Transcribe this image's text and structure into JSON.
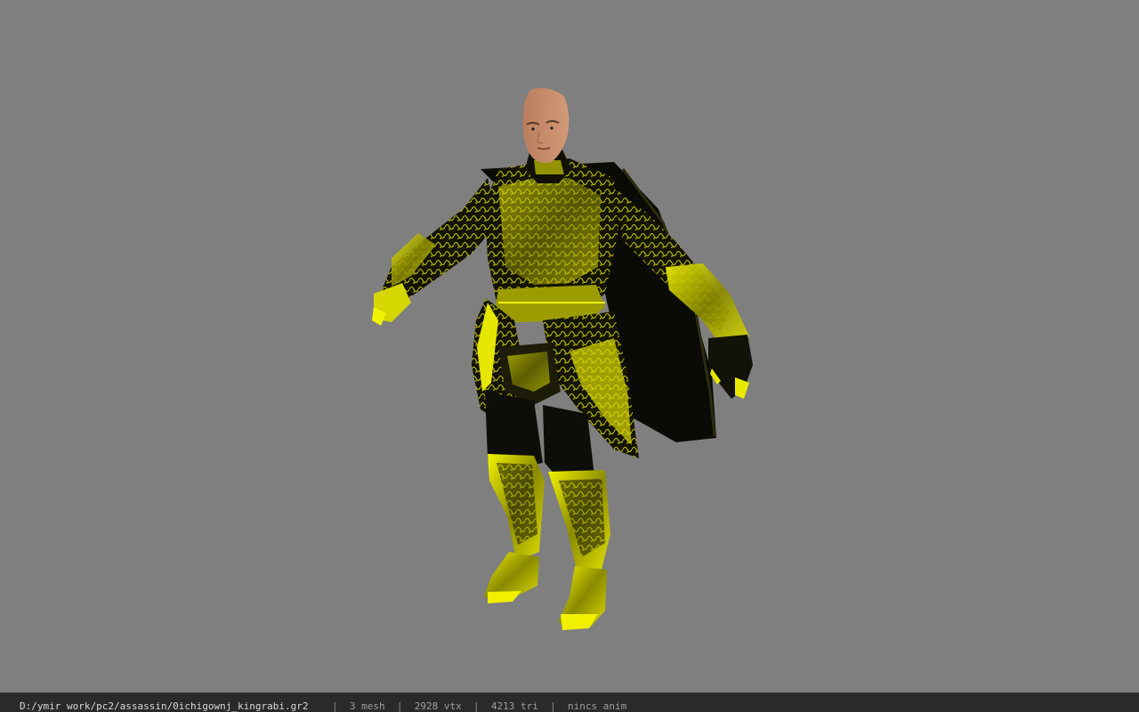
{
  "viewport": {
    "background": "#7f7f7f",
    "model_name": "armored-character-model",
    "armor_color": "#e0e000",
    "skin_color": "#c08c6c"
  },
  "status_bar": {
    "file_path": "D:/ymir work/pc2/assassin/0ichigownj_kingrabi.gr2",
    "separator": "|",
    "mesh": "3 mesh",
    "vertices": "2928 vtx",
    "triangles": "4213 tri",
    "animation": "nincs anim"
  }
}
